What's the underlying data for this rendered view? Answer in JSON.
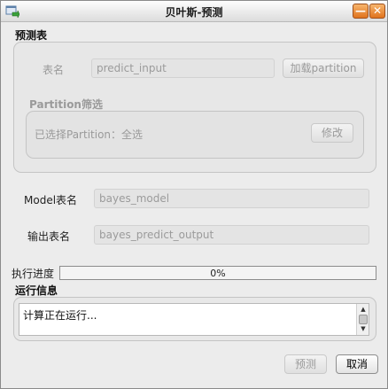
{
  "window": {
    "title": "贝叶斯-预测",
    "minimize_glyph": "—",
    "close_glyph": "✕",
    "app_icon": "window-app-icon"
  },
  "predict_table": {
    "section_title": "预测表",
    "table_label": "表名",
    "table_value": "predict_input",
    "load_button": "加载partition",
    "partition": {
      "title": "Partition筛选",
      "selected_text": "已选择Partition：全选",
      "modify_button": "修改"
    }
  },
  "model": {
    "label": "Model表名",
    "value": "bayes_model"
  },
  "output": {
    "label": "输出表名",
    "value": "bayes_predict_output"
  },
  "progress": {
    "label": "执行进度",
    "text": "0%",
    "value": 0
  },
  "run_info": {
    "section_title": "运行信息",
    "message": "计算正在运行..."
  },
  "buttons": {
    "predict": "预测",
    "cancel": "取消"
  },
  "colors": {
    "title_buttons": "#e0731d",
    "progress_fill": "#6a9fd6"
  }
}
